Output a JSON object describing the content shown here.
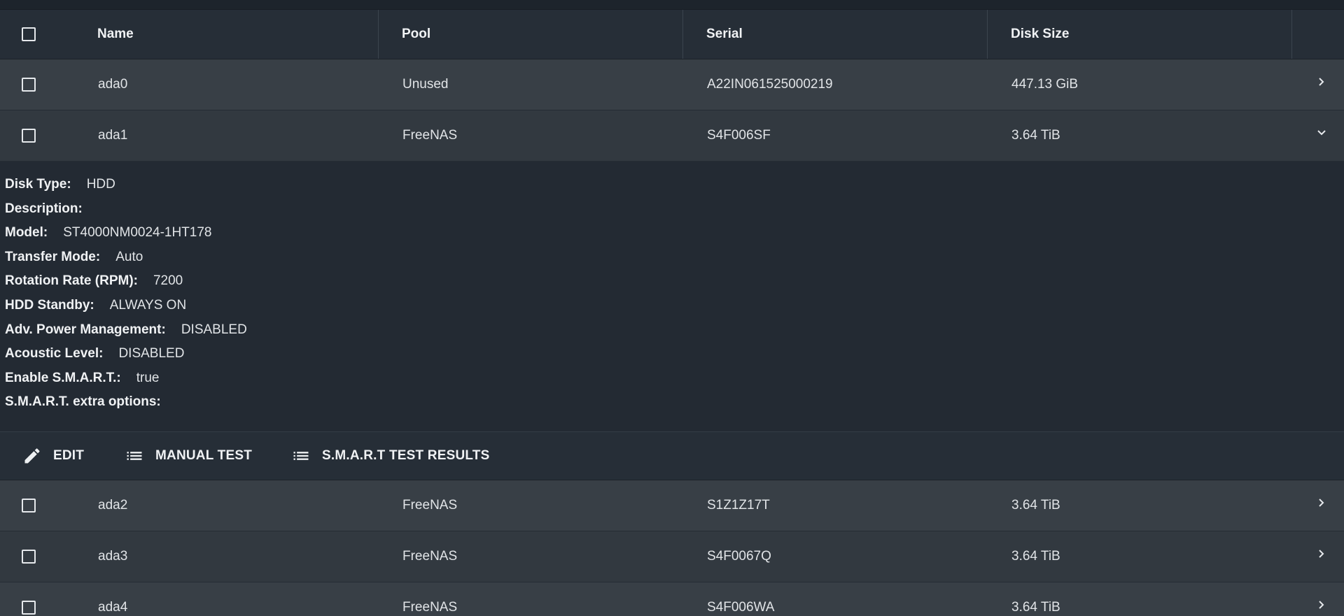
{
  "table": {
    "headers": {
      "name": "Name",
      "pool": "Pool",
      "serial": "Serial",
      "disk_size": "Disk Size"
    },
    "rows": [
      {
        "name": "ada0",
        "pool": "Unused",
        "serial": "A22IN061525000219",
        "disk_size": "447.13 GiB",
        "expanded": false
      },
      {
        "name": "ada1",
        "pool": "FreeNAS",
        "serial": "S4F006SF",
        "disk_size": "3.64 TiB",
        "expanded": true
      },
      {
        "name": "ada2",
        "pool": "FreeNAS",
        "serial": "S1Z1Z17T",
        "disk_size": "3.64 TiB",
        "expanded": false
      },
      {
        "name": "ada3",
        "pool": "FreeNAS",
        "serial": "S4F0067Q",
        "disk_size": "3.64 TiB",
        "expanded": false
      },
      {
        "name": "ada4",
        "pool": "FreeNAS",
        "serial": "S4F006WA",
        "disk_size": "3.64 TiB",
        "expanded": false
      }
    ]
  },
  "details": [
    {
      "label": "Disk Type:",
      "value": "HDD"
    },
    {
      "label": "Description:",
      "value": ""
    },
    {
      "label": "Model:",
      "value": "ST4000NM0024-1HT178"
    },
    {
      "label": "Transfer Mode:",
      "value": "Auto"
    },
    {
      "label": "Rotation Rate (RPM):",
      "value": "7200"
    },
    {
      "label": "HDD Standby:",
      "value": "ALWAYS ON"
    },
    {
      "label": "Adv. Power Management:",
      "value": "DISABLED"
    },
    {
      "label": "Acoustic Level:",
      "value": "DISABLED"
    },
    {
      "label": "Enable S.M.A.R.T.:",
      "value": "true"
    },
    {
      "label": "S.M.A.R.T. extra options:",
      "value": ""
    }
  ],
  "actions": {
    "edit": "EDIT",
    "manual_test": "MANUAL TEST",
    "smart_results": "S.M.A.R.T TEST RESULTS"
  },
  "icons": {
    "edit": "pencil-icon",
    "manual_test": "list-icon",
    "smart_results": "list-icon",
    "row_collapsed": "chevron-right-icon",
    "row_expanded": "chevron-down-icon"
  },
  "colors": {
    "background": "#232a33",
    "header": "#262e37",
    "row_alt_a": "#383f46",
    "row_alt_b": "#323940"
  }
}
